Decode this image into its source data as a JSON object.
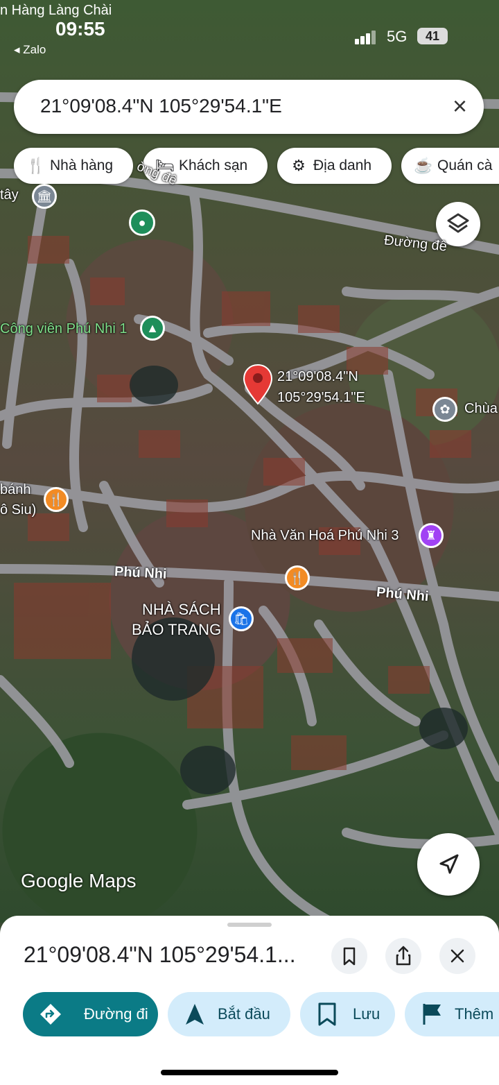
{
  "status_bar": {
    "carrier_text": "n Hàng Làng Chài",
    "time": "09:55",
    "back_app": "◂ Zalo",
    "network": "5G",
    "battery": "41"
  },
  "search": {
    "query": "21°09'08.4\"N 105°29'54.1\"E",
    "close_icon": "×"
  },
  "chips": [
    {
      "label": "Nhà hàng",
      "icon": "fork-knife-icon"
    },
    {
      "label": "Khách sạn",
      "icon": "bed-icon"
    },
    {
      "label": "Địa danh",
      "icon": "landmark-icon"
    },
    {
      "label": "Quán cà",
      "icon": "coffee-icon"
    }
  ],
  "map_labels": {
    "duong_de_1": "Đường đê",
    "duong_de_top": "ờng đê",
    "tay": "tây",
    "cong_vien": "Công viên Phú Nhi 1",
    "pin_lat": "21°09'08.4\"N",
    "pin_lng": "105°29'54.1\"E",
    "chua": "Chùa",
    "banh": "bánh",
    "siu": "ô Siu)",
    "nha_van_hoa": "Nhà Văn Hoá Phú Nhi 3",
    "phu_nhi_left": "Phú Nhi",
    "phu_nhi_right": "Phú Nhi",
    "nha_sach_1": "NHÀ SÁCH",
    "nha_sach_2": "BẢO TRANG",
    "google_maps": "Google Maps"
  },
  "sheet": {
    "title": "21°09'08.4\"N 105°29'54.1...",
    "actions": [
      {
        "label": "Đường đi",
        "icon": "directions-icon"
      },
      {
        "label": "Bắt đầu",
        "icon": "navigation-arrow-icon"
      },
      {
        "label": "Lưu",
        "icon": "bookmark-icon"
      },
      {
        "label": "Thêm",
        "icon": "flag-icon"
      }
    ]
  },
  "colors": {
    "teal": "#0b7b86",
    "chip_blue": "#d3ecfb",
    "pin_red": "#e53935",
    "poi_orange": "#f28b24",
    "poi_purple": "#a142f4",
    "poi_green": "#1e8e5a",
    "poi_blue": "#1a73e8",
    "poi_gray": "#7b8794"
  }
}
